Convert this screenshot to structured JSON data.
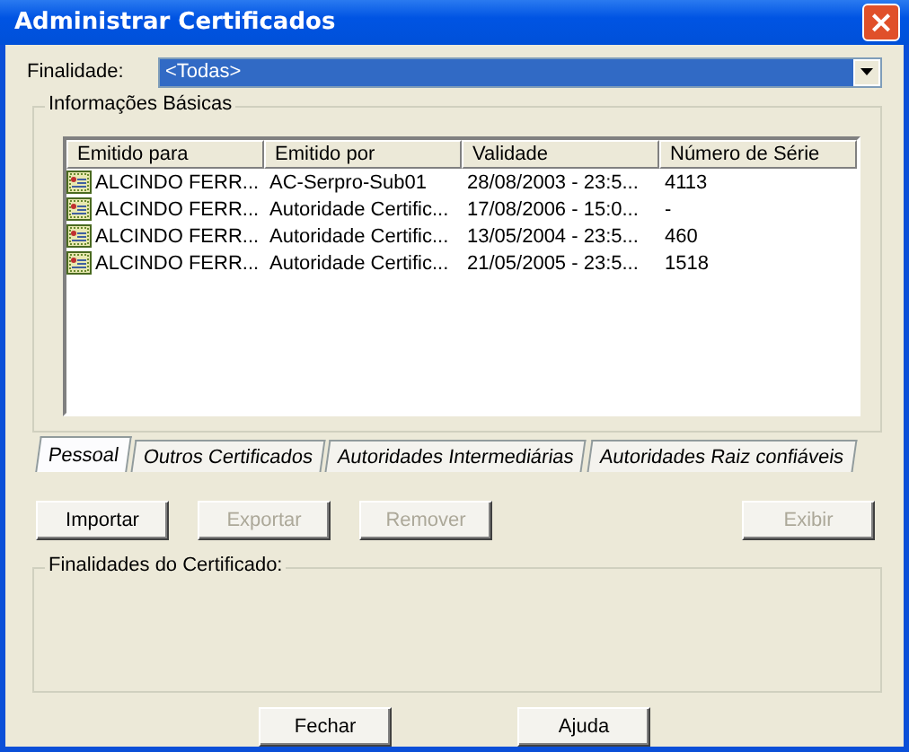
{
  "window": {
    "title": "Administrar Certificados",
    "close": "×"
  },
  "purpose": {
    "label": "Finalidade:",
    "value": "<Todas>"
  },
  "basic_info": {
    "title": "Informações Básicas",
    "table": {
      "columns": [
        "Emitido para",
        "Emitido por",
        "Validade",
        "Número de Série"
      ],
      "rows": [
        {
          "cells": [
            "ALCINDO FERR...",
            "AC-Serpro-Sub01",
            "28/08/2003 - 23:5...",
            "4113"
          ],
          "selected": false
        },
        {
          "cells": [
            "ALCINDO FERR...",
            "Autoridade Certific...",
            "17/08/2006 - 15:0...",
            "-"
          ],
          "selected": false
        },
        {
          "cells": [
            "ALCINDO FERR...",
            "Autoridade Certific...",
            "13/05/2004 - 23:5...",
            "460"
          ],
          "selected": false
        },
        {
          "cells": [
            "ALCINDO FERR...",
            "Autoridade Certific...",
            "21/05/2005 - 23:5...",
            "1518"
          ],
          "selected": false
        }
      ]
    }
  },
  "tabs": [
    {
      "label": "Pessoal",
      "selected": true
    },
    {
      "label": "Outros Certificados",
      "selected": false
    },
    {
      "label": "Autoridades Intermediárias",
      "selected": false
    },
    {
      "label": "Autoridades Raiz confiáveis",
      "selected": false
    }
  ],
  "actions": [
    {
      "label": "Importar",
      "disabled": false
    },
    {
      "label": "Exportar",
      "disabled": true
    },
    {
      "label": "Remover",
      "disabled": true
    },
    {
      "label": "Exibir",
      "disabled": true
    }
  ],
  "purposes_group": {
    "title": "Finalidades do Certificado:"
  },
  "buttons": [
    "Fechar",
    "Ajuda"
  ]
}
